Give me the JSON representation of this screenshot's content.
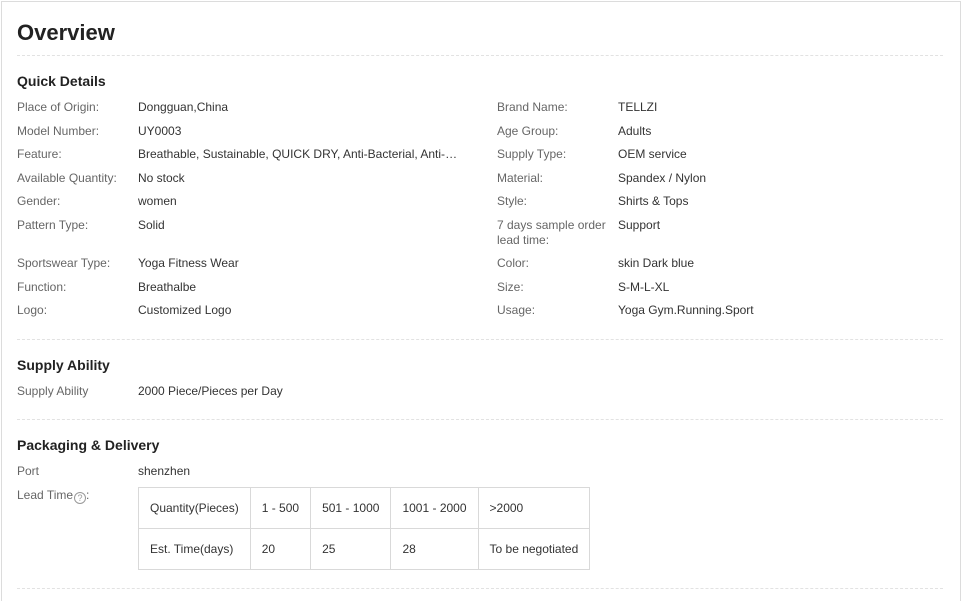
{
  "overview": {
    "title": "Overview"
  },
  "quick_details": {
    "title": "Quick Details",
    "left": [
      {
        "label": "Place of Origin:",
        "value": "Dongguan,China"
      },
      {
        "label": "Model Number:",
        "value": "UY0003"
      },
      {
        "label": "Feature:",
        "value": "Breathable, Sustainable, QUICK DRY, Anti-Bacterial, Anti-Stat…"
      },
      {
        "label": "Available Quantity:",
        "value": "No stock"
      },
      {
        "label": "Gender:",
        "value": "women"
      },
      {
        "label": "Pattern Type:",
        "value": "Solid"
      },
      {
        "label": "Sportswear Type:",
        "value": "Yoga Fitness Wear"
      },
      {
        "label": "Function:",
        "value": "Breathalbe"
      },
      {
        "label": "Logo:",
        "value": "Customized Logo"
      }
    ],
    "right": [
      {
        "label": "Brand Name:",
        "value": "TELLZI"
      },
      {
        "label": "Age Group:",
        "value": "Adults"
      },
      {
        "label": "Supply Type:",
        "value": "OEM service"
      },
      {
        "label": "Material:",
        "value": "Spandex / Nylon"
      },
      {
        "label": "Style:",
        "value": "Shirts & Tops"
      },
      {
        "label": "7 days sample order lead time:",
        "value": "Support"
      },
      {
        "label": "Color:",
        "value": "skin Dark blue"
      },
      {
        "label": "Size:",
        "value": "S-M-L-XL"
      },
      {
        "label": "Usage:",
        "value": "Yoga Gym.Running.Sport"
      }
    ]
  },
  "supply_ability": {
    "title": "Supply Ability",
    "label": "Supply Ability",
    "value": "2000 Piece/Pieces per Day"
  },
  "packaging": {
    "title": "Packaging & Delivery",
    "port_label": "Port",
    "port_value": "shenzhen",
    "lead_time_label": "Lead Time",
    "lead_time_suffix": ":",
    "help_icon": "question-circle-icon",
    "help_glyph": "?",
    "table": {
      "rows": [
        [
          "Quantity(Pieces)",
          "1 - 500",
          "501 - 1000",
          "1001 - 2000",
          ">2000"
        ],
        [
          "Est. Time(days)",
          "20",
          "25",
          "28",
          "To be negotiated"
        ]
      ]
    }
  }
}
